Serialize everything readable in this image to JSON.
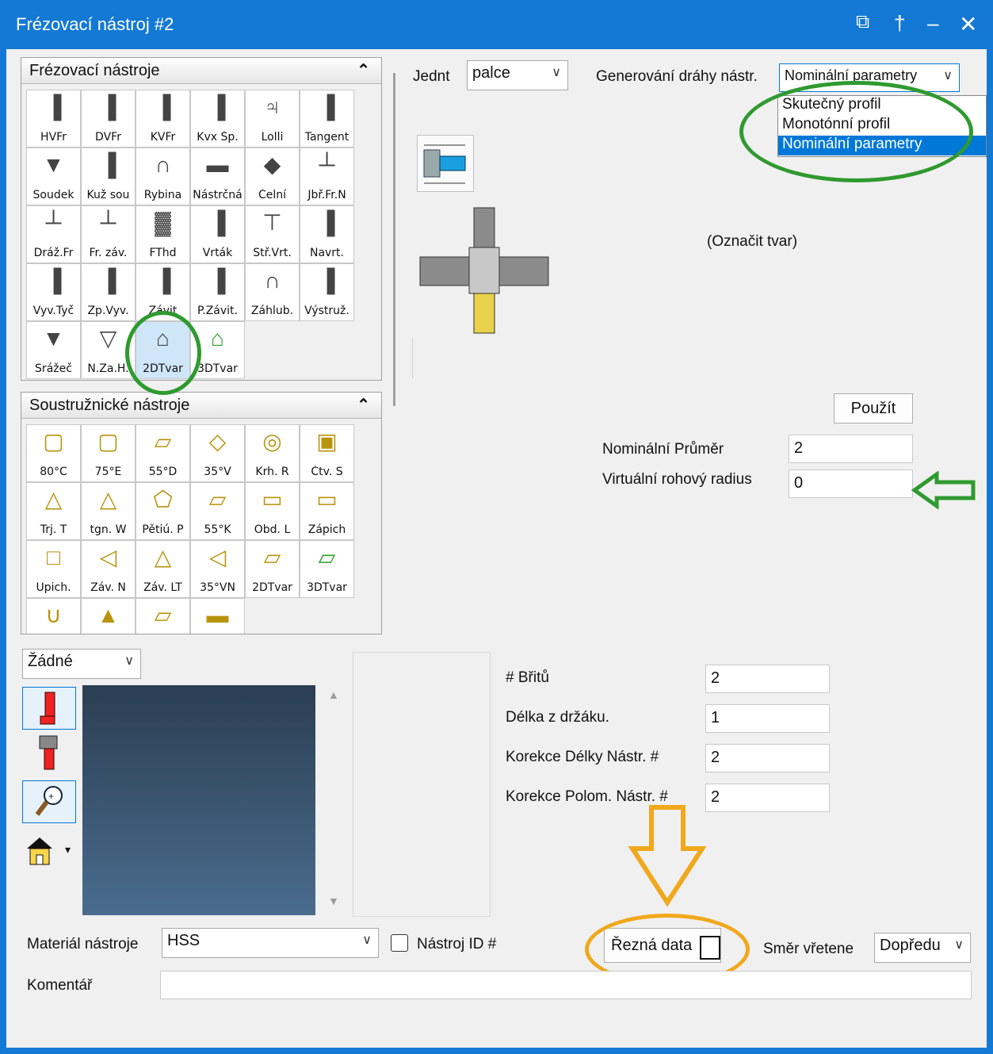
{
  "window": {
    "title": "Frézovací nástroj #2"
  },
  "titlebar_icons": [
    "restore-window-icon",
    "pin-icon",
    "minimize-icon",
    "close-icon"
  ],
  "milling_panel": {
    "title": "Frézovací nástroje",
    "tools": [
      "HVFr",
      "DVFr",
      "KVFr",
      "Kvx Šp.",
      "Lolli",
      "Tangent",
      "Soudek",
      "Kuž sou",
      "Rybina",
      "Nástrčná",
      "Čelní",
      "Jbř.Fr.N",
      "Dráž.Fr",
      "Fr. záv.",
      "FThd",
      "Vrták",
      "Stř.Vrt.",
      "Navrt.",
      "Vyv.Tyč",
      "Zp.Vyv.",
      "Závit",
      "P.Závit.",
      "Záhlub.",
      "Výstruž.",
      "Srážeč",
      "N.Za.H.",
      "2DTvar",
      "3DTvar"
    ],
    "selected": "2DTvar"
  },
  "turning_panel": {
    "title": "Soustružnické nástroje",
    "tools": [
      "80°C",
      "75°E",
      "55°D",
      "35°V",
      "Krh. R",
      "Čtv. S",
      "Trj. T",
      "tgn. W",
      "Pětiú. P",
      "55°K",
      "Obd. L",
      "Zápich",
      "Upich.",
      "Záv. N",
      "Záv. LT",
      "35°VN",
      "2DTvar",
      "3DTvar",
      "",
      "",
      "",
      ""
    ]
  },
  "units": {
    "label": "Jednt",
    "value": "palce"
  },
  "toolpath": {
    "label": "Generování dráhy nástr.",
    "value": "Nominální parametry",
    "options": [
      "Skutečný profil",
      "Monotónní profil",
      "Nominální parametry"
    ],
    "selected_index": 2
  },
  "shape_hint": "(Označit tvar)",
  "apply_button": "Použít",
  "nominal_diameter": {
    "label": "Nominální Průměr",
    "value": "2"
  },
  "virtual_corner_radius": {
    "label": "Virtuální rohový radius",
    "value": "0"
  },
  "view_select": {
    "value": "Žádné"
  },
  "fields": [
    {
      "label": "# Břitů",
      "value": "2"
    },
    {
      "label": "Délka z držáku.",
      "value": "1"
    },
    {
      "label": "Korekce Délky Nástr. #",
      "value": "2"
    },
    {
      "label": "Korekce Polom. Nástr. #",
      "value": "2"
    }
  ],
  "material": {
    "label": "Materiál nástroje",
    "value": "HSS"
  },
  "tool_id": {
    "label": "Nástroj ID #",
    "checked": false
  },
  "cutting_data": {
    "label": "Řezná data"
  },
  "spindle": {
    "label": "Směr vřetene",
    "value": "Dopředu"
  },
  "comment": {
    "label": "Komentář",
    "value": ""
  },
  "colors": {
    "title_bar": "#1479d4",
    "annotation_green": "#2f9a2f",
    "annotation_orange": "#f0a81c",
    "highlight": "#0078d7"
  }
}
